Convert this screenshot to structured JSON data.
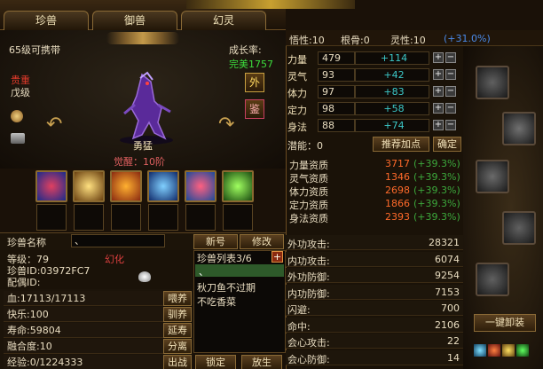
{
  "tabs": [
    "珍兽",
    "御兽",
    "幻灵"
  ],
  "pet": {
    "level_carry": "65级可携带",
    "growth_label": "成长率:",
    "growth_value": "完美1757",
    "rarity": "贵重",
    "grade": "戊级",
    "name": "勇猛",
    "awaken": "觉醒：10阶",
    "btn_outer": "外",
    "btn_appraise": "鉴"
  },
  "skills": [
    "blue-beast-skill-icon",
    "gold-warrior-skill-icon",
    "fire-skill-icon",
    "ice-skill-icon",
    "water-orb-skill-icon",
    "green-poison-skill-icon"
  ],
  "namebar": {
    "label": "珍兽名称",
    "value": "、",
    "rename": "新号",
    "modify": "修改"
  },
  "info": {
    "level": "等级：79",
    "transform": "幻化",
    "id": "珍兽ID:03972FC7",
    "partner": "配偶ID:"
  },
  "petlist": {
    "title": "珍兽列表3/6",
    "plus": "+",
    "items": [
      "、",
      "秋刀鱼不过期",
      "不吃香菜"
    ]
  },
  "status": [
    {
      "label": "血:17113/17113",
      "btn": "喂养"
    },
    {
      "label": "快乐:100",
      "btn": "驯养"
    },
    {
      "label": "寿命:59804",
      "btn": "延寿"
    },
    {
      "label": "融合度:10",
      "btn": "分离"
    },
    {
      "label": "经验:0/1224333",
      "btn": "出战"
    }
  ],
  "bottom_btns": {
    "lock": "锁定",
    "release": "放生"
  },
  "topstats": {
    "wisdom": "悟性:10",
    "root": "根骨:0",
    "spirit": "灵性:10",
    "spirit_bonus": "(+31.0%)"
  },
  "attrs": [
    {
      "label": "力量",
      "base": "479",
      "add": "+114"
    },
    {
      "label": "灵气",
      "base": "93",
      "add": "+42"
    },
    {
      "label": "体力",
      "base": "97",
      "add": "+83"
    },
    {
      "label": "定力",
      "base": "98",
      "add": "+58"
    },
    {
      "label": "身法",
      "base": "88",
      "add": "+74"
    }
  ],
  "potential": {
    "label": "潜能：0",
    "recommend": "推荐加点",
    "confirm": "确定"
  },
  "aptitudes": [
    {
      "label": "力量资质",
      "value": "3717",
      "bonus": "(+39.3%)"
    },
    {
      "label": "灵气资质",
      "value": "1346",
      "bonus": "(+39.3%)"
    },
    {
      "label": "体力资质",
      "value": "2698",
      "bonus": "(+39.3%)"
    },
    {
      "label": "定力资质",
      "value": "1866",
      "bonus": "(+39.3%)"
    },
    {
      "label": "身法资质",
      "value": "2393",
      "bonus": "(+39.3%)"
    }
  ],
  "combat": [
    {
      "label": "外功攻击:",
      "value": "28321"
    },
    {
      "label": "内功攻击:",
      "value": "6074"
    },
    {
      "label": "外功防御:",
      "value": "9254"
    },
    {
      "label": "内功防御:",
      "value": "7153"
    },
    {
      "label": "闪避:",
      "value": "700"
    },
    {
      "label": "命中:",
      "value": "2106"
    },
    {
      "label": "会心攻击:",
      "value": "22"
    },
    {
      "label": "会心防御:",
      "value": "14"
    }
  ],
  "equip_btn": "一键卸装",
  "equip_slots": [
    "claw-armor-icon",
    "talon-icon",
    "scale-armor-icon",
    "fang-icon",
    "blade-tail-icon"
  ]
}
